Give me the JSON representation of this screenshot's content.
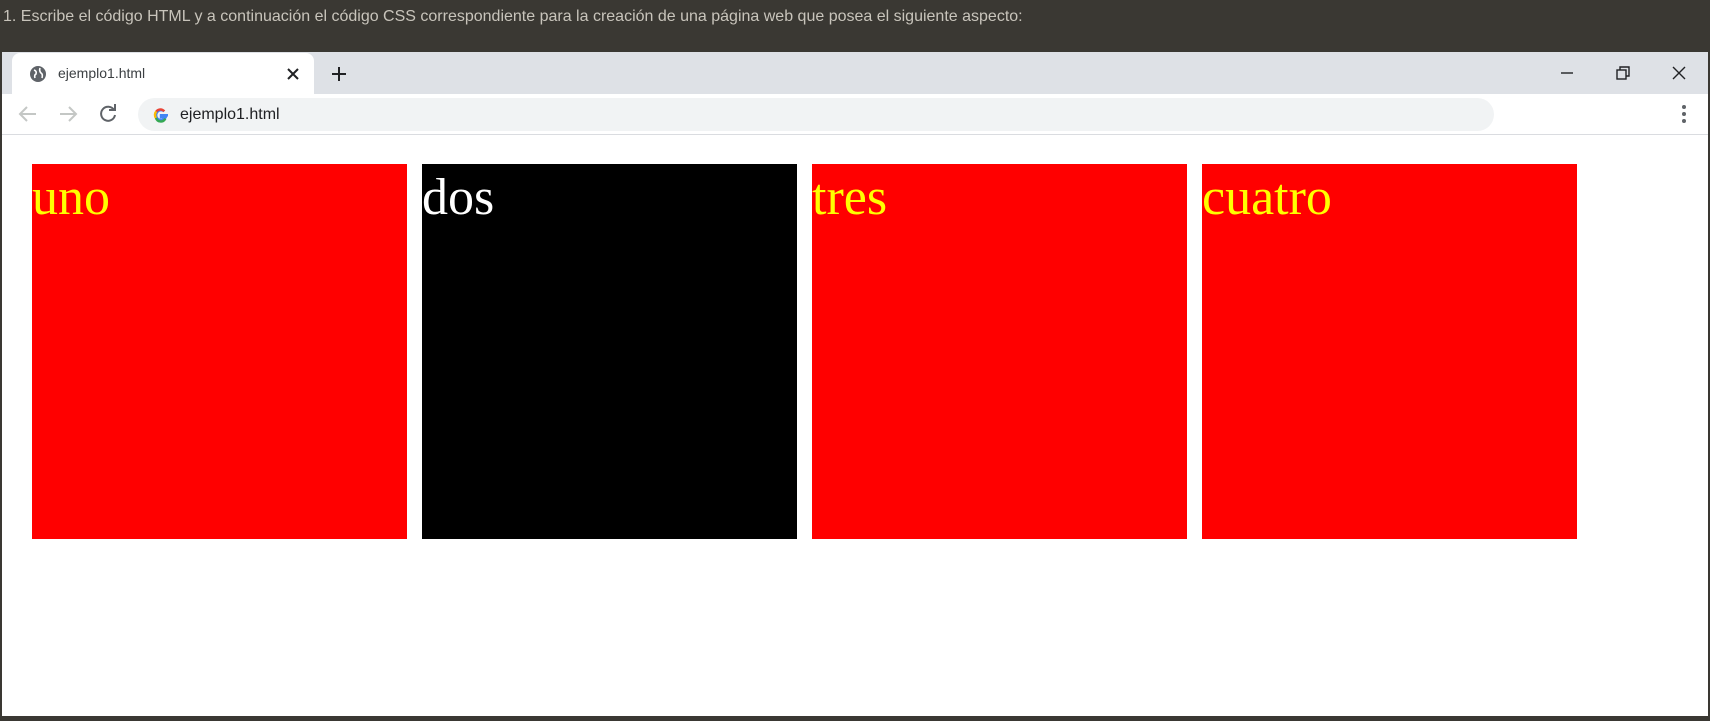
{
  "instruction": "1. Escribe el código HTML y a continuación el código CSS correspondiente para la creación de una página web que posea el siguiente aspecto:",
  "browser": {
    "tab": {
      "title": "ejemplo1.html",
      "favicon": "globe-icon"
    },
    "address_bar": {
      "url": "ejemplo1.html",
      "icon": "google-icon"
    },
    "controls": [
      "back-icon",
      "forward-icon",
      "reload-icon",
      "kebab-menu-icon"
    ],
    "window_controls": [
      "minimize-icon",
      "restore-icon",
      "close-icon"
    ]
  },
  "page": {
    "boxes": [
      {
        "label": "uno",
        "background": "#ff0000",
        "text_color": "#ffff00"
      },
      {
        "label": "dos",
        "background": "#000000",
        "text_color": "#ffffff"
      },
      {
        "label": "tres",
        "background": "#ff0000",
        "text_color": "#ffff00"
      },
      {
        "label": "cuatro",
        "background": "#ff0000",
        "text_color": "#ffff00"
      }
    ]
  }
}
